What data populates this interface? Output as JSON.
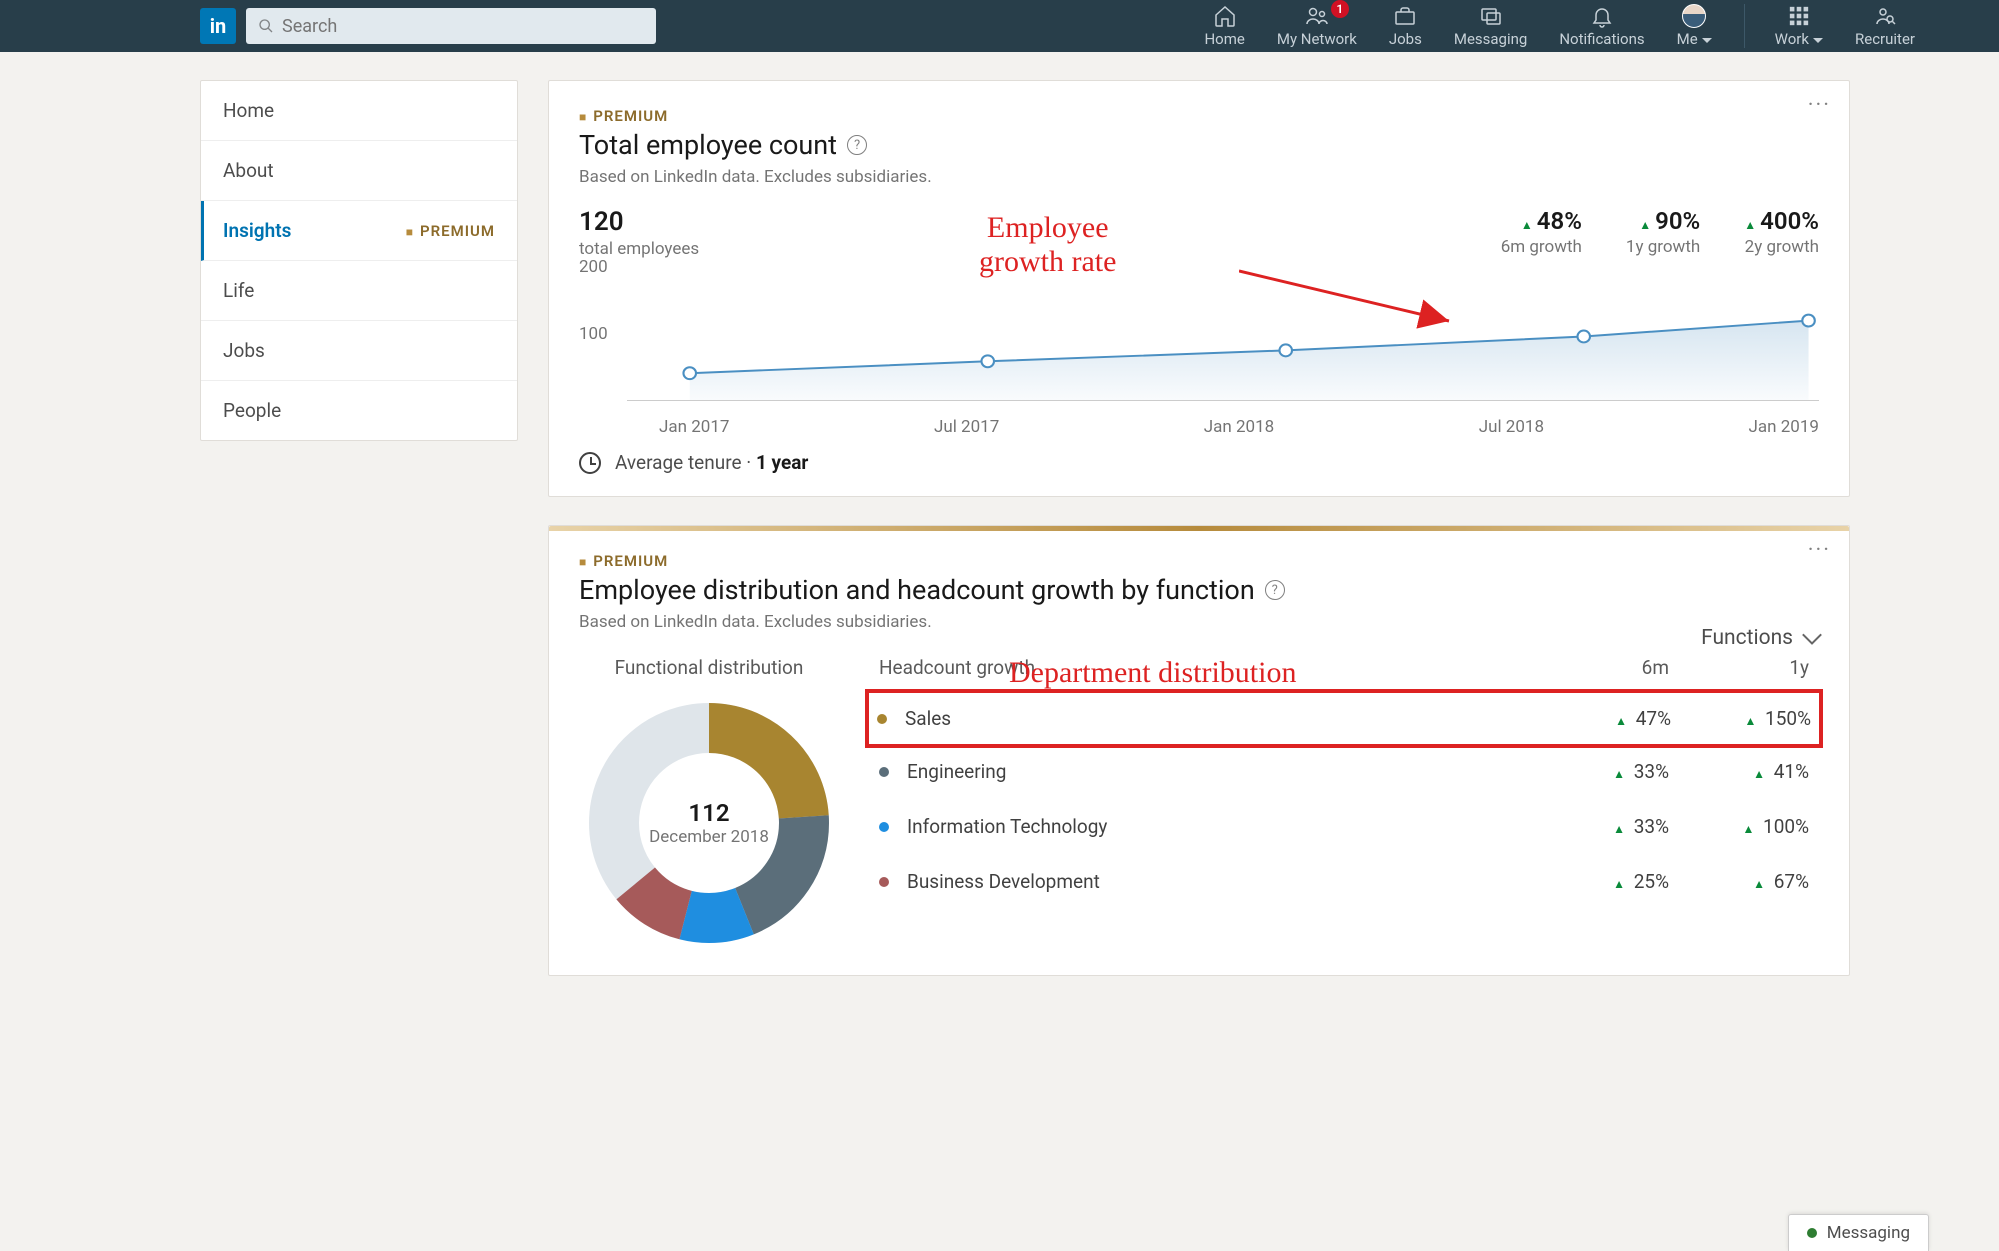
{
  "nav": {
    "search_placeholder": "Search",
    "items": [
      {
        "label": "Home"
      },
      {
        "label": "My Network",
        "badge": "1"
      },
      {
        "label": "Jobs"
      },
      {
        "label": "Messaging"
      },
      {
        "label": "Notifications"
      },
      {
        "label": "Me"
      },
      {
        "label": "Work"
      },
      {
        "label": "Recruiter"
      }
    ]
  },
  "sidebar": {
    "items": [
      "Home",
      "About",
      "Insights",
      "Life",
      "Jobs",
      "People"
    ],
    "premium_label": "PREMIUM"
  },
  "card1": {
    "premium": "PREMIUM",
    "title": "Total employee count",
    "subtitle": "Based on LinkedIn data. Excludes subsidiaries.",
    "total_value": "120",
    "total_label": "total employees",
    "growths": [
      {
        "pct": "48%",
        "label": "6m growth"
      },
      {
        "pct": "90%",
        "label": "1y growth"
      },
      {
        "pct": "400%",
        "label": "2y growth"
      }
    ],
    "tenure_label": "Average tenure",
    "tenure_value": "1 year",
    "annotation": "Employee\ngrowth rate"
  },
  "card2": {
    "premium": "PREMIUM",
    "title": "Employee distribution and headcount growth by function",
    "subtitle": "Based on LinkedIn data. Excludes subsidiaries.",
    "toggle": "Functions",
    "donut_title": "Functional distribution",
    "donut_value": "112",
    "donut_date": "December 2018",
    "growth_header": {
      "h1": "Headcount growth",
      "h2": "6m",
      "h3": "1y"
    },
    "rows": [
      {
        "name": "Sales",
        "color": "#a88530",
        "v6": "47%",
        "v1y": "150%",
        "highlight": true
      },
      {
        "name": "Engineering",
        "color": "#5b6e7a",
        "v6": "33%",
        "v1y": "41%"
      },
      {
        "name": "Information Technology",
        "color": "#1f8ee0",
        "v6": "33%",
        "v1y": "100%"
      },
      {
        "name": "Business Development",
        "color": "#a65a5a",
        "v6": "25%",
        "v1y": "67%"
      }
    ],
    "annotation": "Department distribution"
  },
  "messaging_dock": "Messaging",
  "chart_data": {
    "type": "line",
    "title": "Total employee count",
    "ylabel": "",
    "ylim": [
      0,
      200
    ],
    "yticks": [
      100,
      200
    ],
    "categories": [
      "Jan 2017",
      "Jul 2017",
      "Jan 2018",
      "Jul 2018",
      "Jan 2019"
    ],
    "values": [
      40,
      58,
      75,
      96,
      120
    ],
    "series_name": "total employees"
  },
  "donut_chart_data": {
    "type": "pie",
    "title": "Functional distribution",
    "center_value": 112,
    "center_label": "December 2018",
    "slices": [
      {
        "name": "Sales",
        "color": "#a88530",
        "value": 24
      },
      {
        "name": "Engineering",
        "color": "#5b6e7a",
        "value": 20
      },
      {
        "name": "Information Technology",
        "color": "#1f8ee0",
        "value": 10
      },
      {
        "name": "Business Development",
        "color": "#a65a5a",
        "value": 10
      },
      {
        "name": "Other",
        "color": "#dfe5ea",
        "value": 48
      }
    ]
  }
}
